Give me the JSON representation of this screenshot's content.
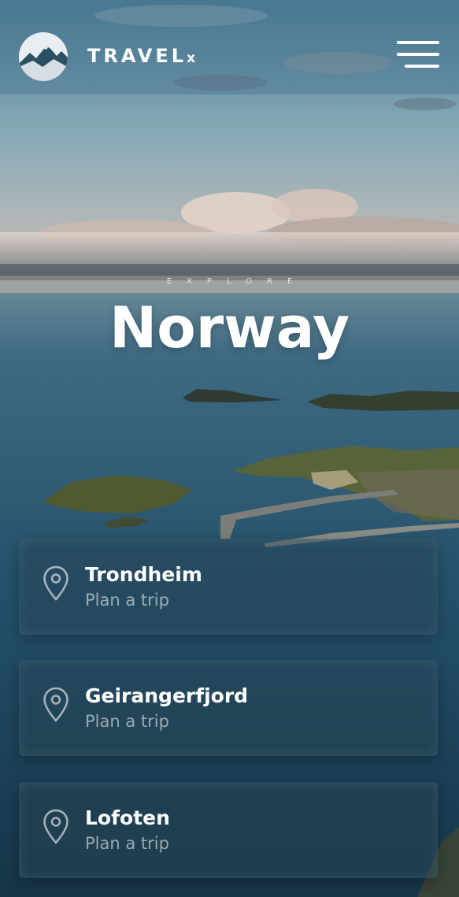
{
  "header": {
    "brand": "TRAVEL",
    "brand_suffix": "x",
    "logo_icon": "mountain-logo-icon",
    "menu_icon": "hamburger-menu-icon"
  },
  "hero": {
    "eyebrow": "EXPLORE",
    "title": "Norway"
  },
  "destinations": [
    {
      "name": "Trondheim",
      "action": "Plan a trip",
      "icon": "location-pin-icon"
    },
    {
      "name": "Geirangerfjord",
      "action": "Plan a trip",
      "icon": "location-pin-icon"
    },
    {
      "name": "Lofoten",
      "action": "Plan a trip",
      "icon": "location-pin-icon"
    }
  ],
  "colors": {
    "sky_top": "#5f8aa0",
    "horizon": "#c9b8ad",
    "sea": "#1f4a63",
    "text": "#ffffff"
  }
}
